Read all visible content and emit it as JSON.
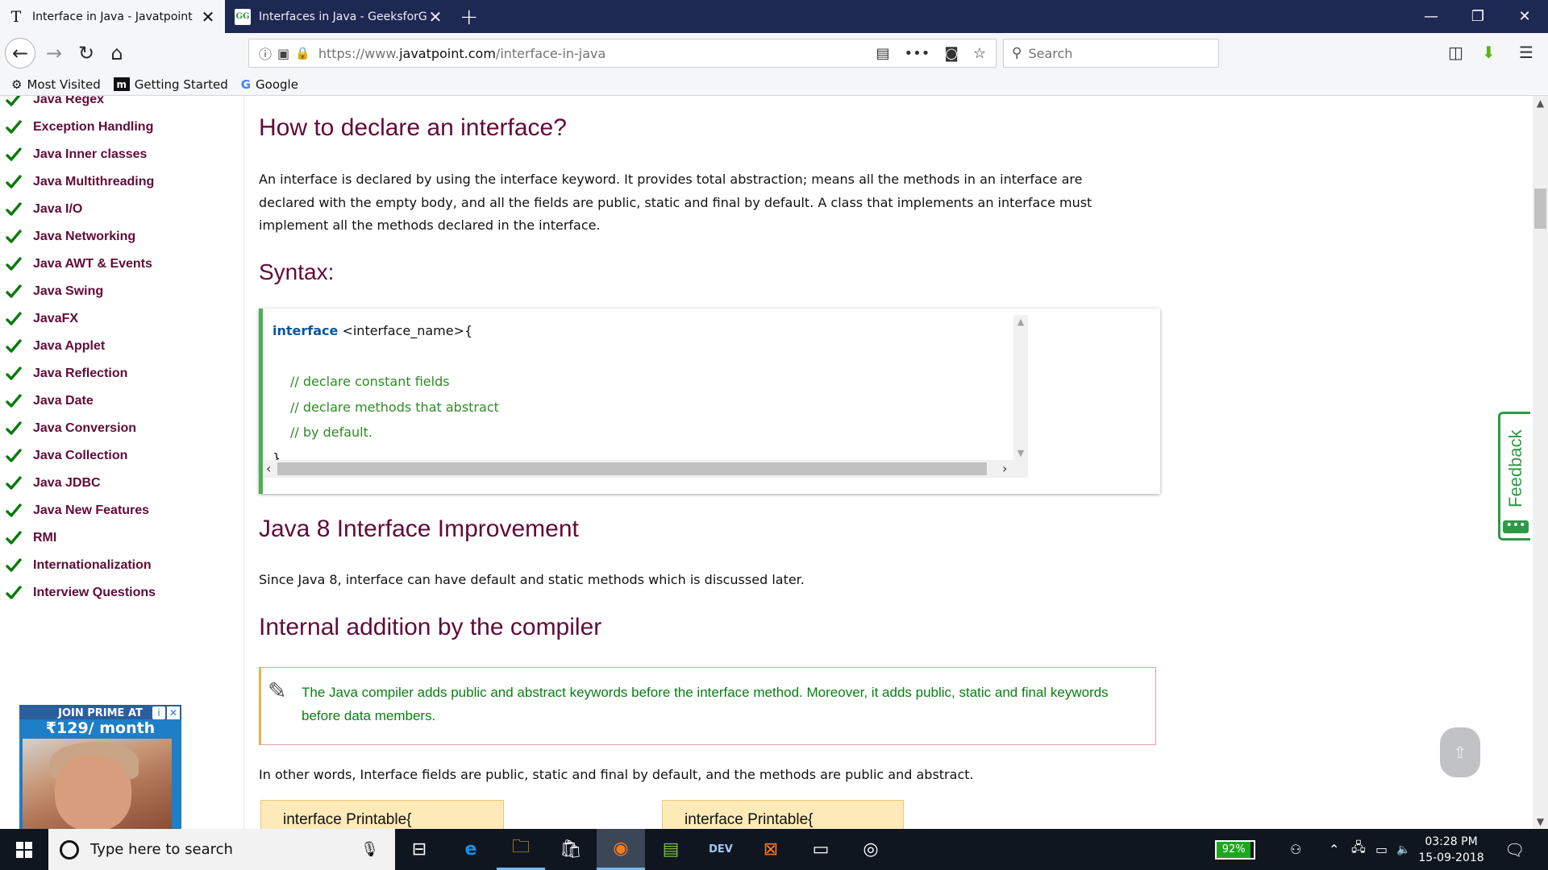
{
  "browser": {
    "tabs": [
      {
        "title": "Interface in Java - Javatpoint",
        "favicon": "T"
      },
      {
        "title": "Interfaces in Java - GeeksforGeeks",
        "favicon": "GG"
      }
    ],
    "url_prefix": "https://www.",
    "url_domain": "javatpoint.com",
    "url_path": "/interface-in-java",
    "search_placeholder": "Search",
    "bookmarks": [
      {
        "label": "Most Visited",
        "icon": "gear-icon"
      },
      {
        "label": "Getting Started",
        "icon": "m-icon"
      },
      {
        "label": "Google",
        "icon": "google-icon"
      }
    ]
  },
  "sidebar": {
    "items": [
      "Java Regex",
      "Exception Handling",
      "Java Inner classes",
      "Java Multithreading",
      "Java I/O",
      "Java Networking",
      "Java AWT & Events",
      "Java Swing",
      "JavaFX",
      "Java Applet",
      "Java Reflection",
      "Java Date",
      "Java Conversion",
      "Java Collection",
      "Java JDBC",
      "Java New Features",
      "RMI",
      "Internationalization",
      "Interview Questions"
    ],
    "check_color": "#0b7a0b"
  },
  "ad": {
    "line1": "JOIN PRIME AT",
    "line2": "₹129/ month"
  },
  "content": {
    "h_declare": "How to declare an interface?",
    "p_declare": "An interface is declared by using the interface keyword. It provides total abstraction; means all the methods in an interface are declared with the empty body, and all the fields are public, static and final by default. A class that implements an interface must implement all the methods declared in the interface.",
    "h_syntax": "Syntax:",
    "code": {
      "keyword": "interface",
      "decl": " <interface_name>{",
      "comments": [
        "// declare constant fields",
        "// declare methods that abstract",
        "// by default."
      ],
      "close": "}"
    },
    "h_java8": "Java 8 Interface Improvement",
    "p_java8": "Since Java 8, interface can have default and static methods which is discussed later.",
    "h_internal": "Internal addition by the compiler",
    "note": "The Java compiler adds public and abstract keywords before the interface method. Moreover, it adds public, static and final keywords before data members.",
    "p_otherwords": "In other words, Interface fields are public, static and final by default, and the methods are public and abstract.",
    "printable_left": "interface Printable{",
    "printable_right": "interface Printable{",
    "feedback": "Feedback",
    "feedback_dots": "•••",
    "to_top": "⇧"
  },
  "taskbar": {
    "search_placeholder": "Type here to search",
    "battery": "92%",
    "battery_level": 0.92,
    "time": "03:28 PM",
    "date": "15-09-2018",
    "apps": [
      "task-view",
      "edge",
      "file-explorer",
      "store",
      "firefox",
      "notepad",
      "dev-cpp",
      "xampp",
      "terminal",
      "obs"
    ]
  },
  "colors": {
    "titlebar": "#1d2853",
    "heading": "#610b38",
    "code_border": "#4caf50",
    "note_text": "#078111",
    "feedback": "#2e9a46"
  }
}
